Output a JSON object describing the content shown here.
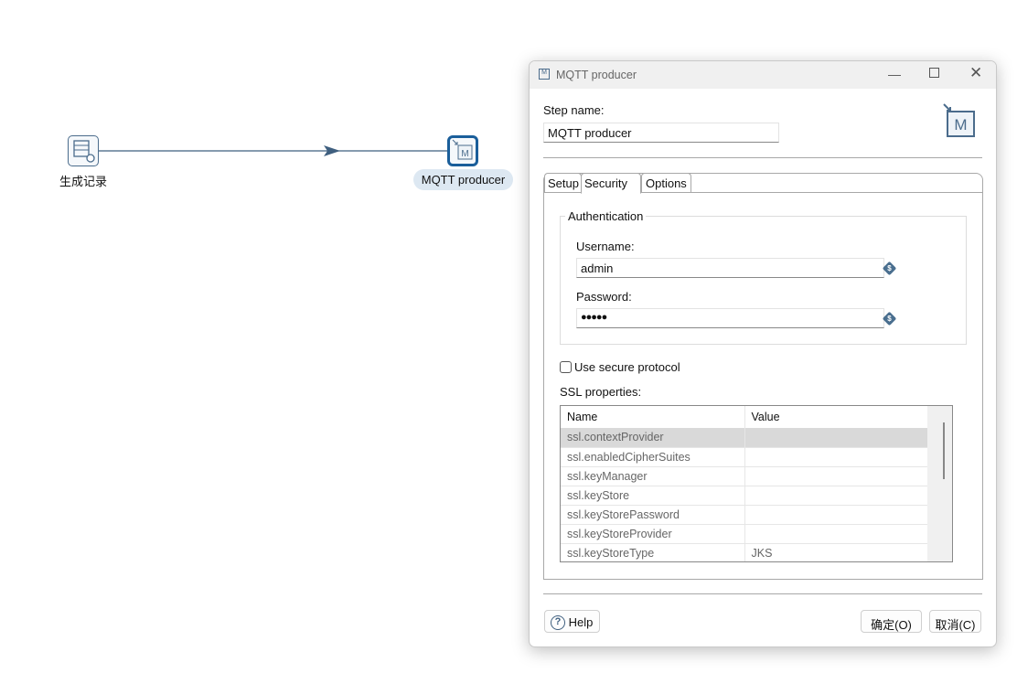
{
  "canvas": {
    "nodes": [
      {
        "label": "生成记录",
        "icon": "generate-rows-icon"
      },
      {
        "label": "MQTT producer",
        "icon": "mqtt-producer-icon",
        "selected": true
      }
    ],
    "hop_color": "#3f5f7f"
  },
  "dialog": {
    "title": "MQTT producer",
    "step_name_label": "Step name:",
    "step_name_value": "MQTT producer",
    "tabs": [
      {
        "label": "Setup"
      },
      {
        "label": "Security",
        "active": true
      },
      {
        "label": "Options"
      }
    ],
    "authentication": {
      "legend": "Authentication",
      "username_label": "Username:",
      "username_value": "admin",
      "password_label": "Password:",
      "password_value": "●●●●●"
    },
    "use_secure_protocol": {
      "label": "Use secure protocol",
      "checked": false
    },
    "ssl": {
      "label": "SSL properties:",
      "columns": [
        "Name",
        "Value"
      ],
      "rows": [
        {
          "name": "ssl.contextProvider",
          "value": ""
        },
        {
          "name": "ssl.enabledCipherSuites",
          "value": ""
        },
        {
          "name": "ssl.keyManager",
          "value": ""
        },
        {
          "name": "ssl.keyStore",
          "value": ""
        },
        {
          "name": "ssl.keyStorePassword",
          "value": ""
        },
        {
          "name": "ssl.keyStoreProvider",
          "value": ""
        },
        {
          "name": "ssl.keyStoreType",
          "value": "JKS"
        }
      ]
    },
    "buttons": {
      "help": "Help",
      "ok": "确定(O)",
      "cancel": "取消(C)"
    }
  }
}
